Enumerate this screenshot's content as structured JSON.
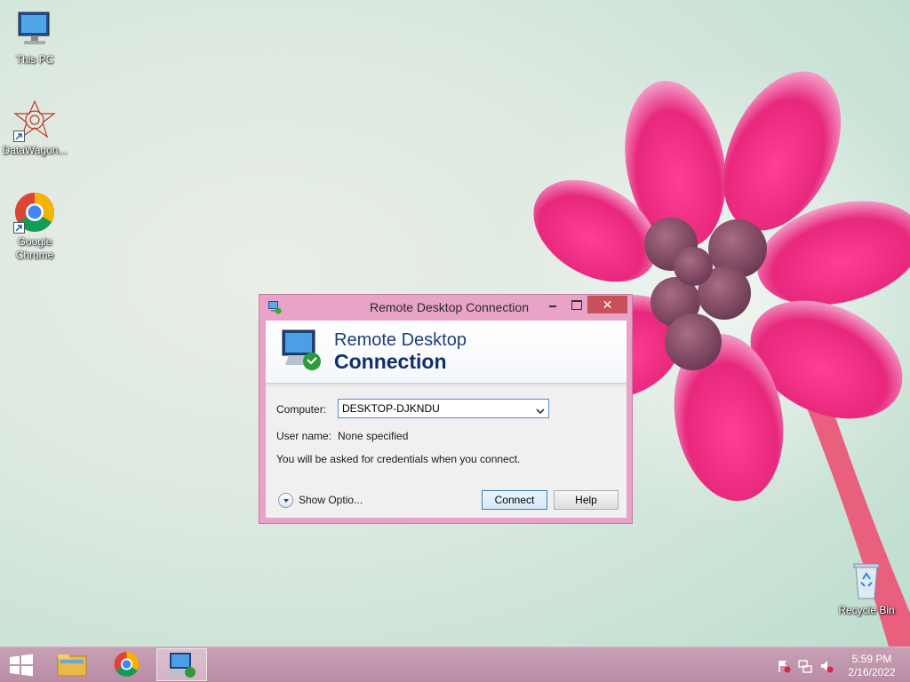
{
  "desktop": {
    "icons": [
      {
        "label": "This PC"
      },
      {
        "label": "DataWagon..."
      },
      {
        "label": "Google Chrome"
      },
      {
        "label": "Recycle Bin"
      }
    ]
  },
  "window": {
    "title": "Remote Desktop Connection",
    "close_glyph": "✕",
    "banner_line1": "Remote Desktop",
    "banner_line2": "Connection",
    "computer_label": "Computer:",
    "computer_value": "DESKTOP-DJKNDU",
    "username_label": "User name:",
    "username_value": "None specified",
    "info_text": "You will be asked for credentials when you connect.",
    "show_options_label": "Show Optio...",
    "connect_label": "Connect",
    "help_label": "Help"
  },
  "taskbar": {
    "time": "5:59 PM",
    "date": "2/16/2022",
    "items": [
      "file-explorer",
      "google-chrome",
      "remote-desktop-connection"
    ]
  },
  "colors": {
    "window_frame": "#e8a3c7",
    "close_button": "#c7505b",
    "banner_text": "#1e3f78",
    "taskbar": "#c8a0b4"
  }
}
